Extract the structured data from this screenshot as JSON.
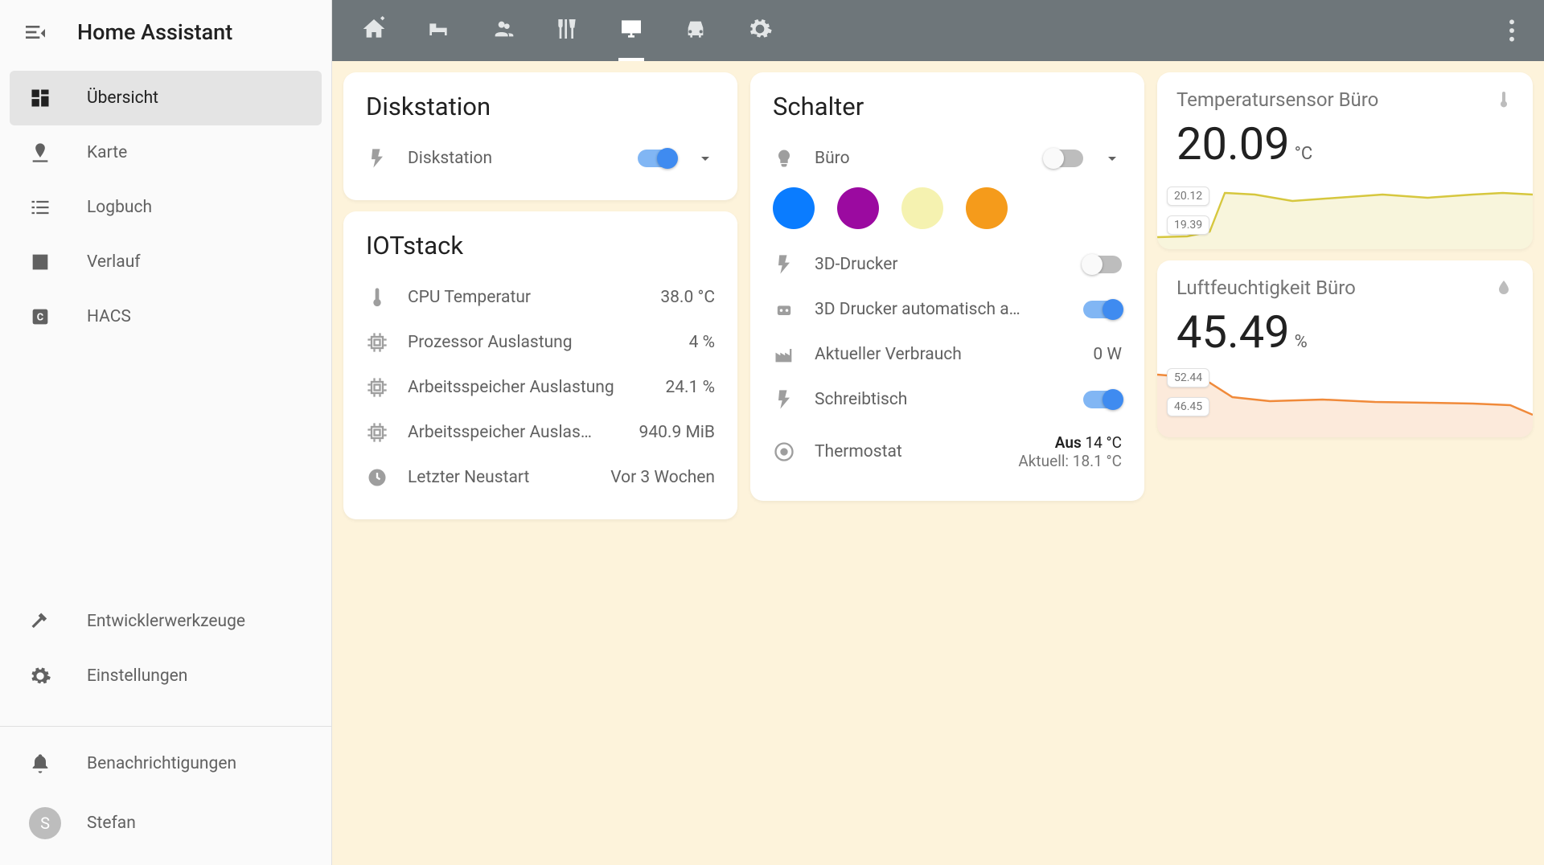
{
  "app": {
    "title": "Home Assistant"
  },
  "sidebar": {
    "items": [
      {
        "label": "Übersicht"
      },
      {
        "label": "Karte"
      },
      {
        "label": "Logbuch"
      },
      {
        "label": "Verlauf"
      },
      {
        "label": "HACS"
      }
    ],
    "bottom": [
      {
        "label": "Entwicklerwerkzeuge"
      },
      {
        "label": "Einstellungen"
      }
    ],
    "footer": [
      {
        "label": "Benachrichtigungen"
      },
      {
        "label": "Stefan",
        "avatar_initial": "S"
      }
    ]
  },
  "cards": {
    "diskstation": {
      "title": "Diskstation",
      "switch": {
        "label": "Diskstation",
        "on": true
      }
    },
    "iotstack": {
      "title": "IOTstack",
      "rows": [
        {
          "label": "CPU Temperatur",
          "value": "38.0 °C"
        },
        {
          "label": "Prozessor Auslastung",
          "value": "4 %"
        },
        {
          "label": "Arbeitsspeicher Auslastung",
          "value": "24.1 %"
        },
        {
          "label": "Arbeitsspeicher Auslas…",
          "value": "940.9 MiB"
        },
        {
          "label": "Letzter Neustart",
          "value": "Vor 3 Wochen"
        }
      ]
    },
    "schalter": {
      "title": "Schalter",
      "buero": {
        "label": "Büro",
        "on": false
      },
      "colors": [
        "#0a7cff",
        "#9b0aa0",
        "#f5f2b0",
        "#f59b1b"
      ],
      "rows": [
        {
          "label": "3D-Drucker",
          "on": false
        },
        {
          "label": "3D Drucker automatisch a…",
          "on": true
        },
        {
          "label": "Aktueller Verbrauch",
          "value": "0 W"
        },
        {
          "label": "Schreibtisch",
          "on": true
        }
      ],
      "thermostat": {
        "label": "Thermostat",
        "state": "Aus",
        "target": "14 °C",
        "current_label": "Aktuell:",
        "current": "18.1 °C"
      }
    },
    "temp_sensor": {
      "title": "Temperatursensor Büro",
      "value": "20.09",
      "unit": "°C",
      "labels": {
        "high": "20.12",
        "low": "19.39"
      }
    },
    "humidity_sensor": {
      "title": "Luftfeuchtigkeit Büro",
      "value": "45.49",
      "unit": "%",
      "labels": {
        "high": "52.44",
        "low": "46.45"
      }
    }
  },
  "chart_data": [
    {
      "type": "line",
      "title": "Temperatursensor Büro",
      "ylabel": "°C",
      "ylim": [
        19.0,
        20.5
      ],
      "values": [
        19.39,
        19.4,
        19.5,
        20.12,
        20.1,
        20.0,
        20.05,
        20.1,
        20.05,
        20.1,
        20.12,
        20.1,
        20.09
      ],
      "color": "#d6c73e"
    },
    {
      "type": "line",
      "title": "Luftfeuchtigkeit Büro",
      "ylabel": "%",
      "ylim": [
        44,
        54
      ],
      "values": [
        52.44,
        52.0,
        49.0,
        47.5,
        47.0,
        47.2,
        47.0,
        46.8,
        46.9,
        46.7,
        46.6,
        46.45,
        45.49
      ],
      "color": "#f08a3a"
    }
  ]
}
